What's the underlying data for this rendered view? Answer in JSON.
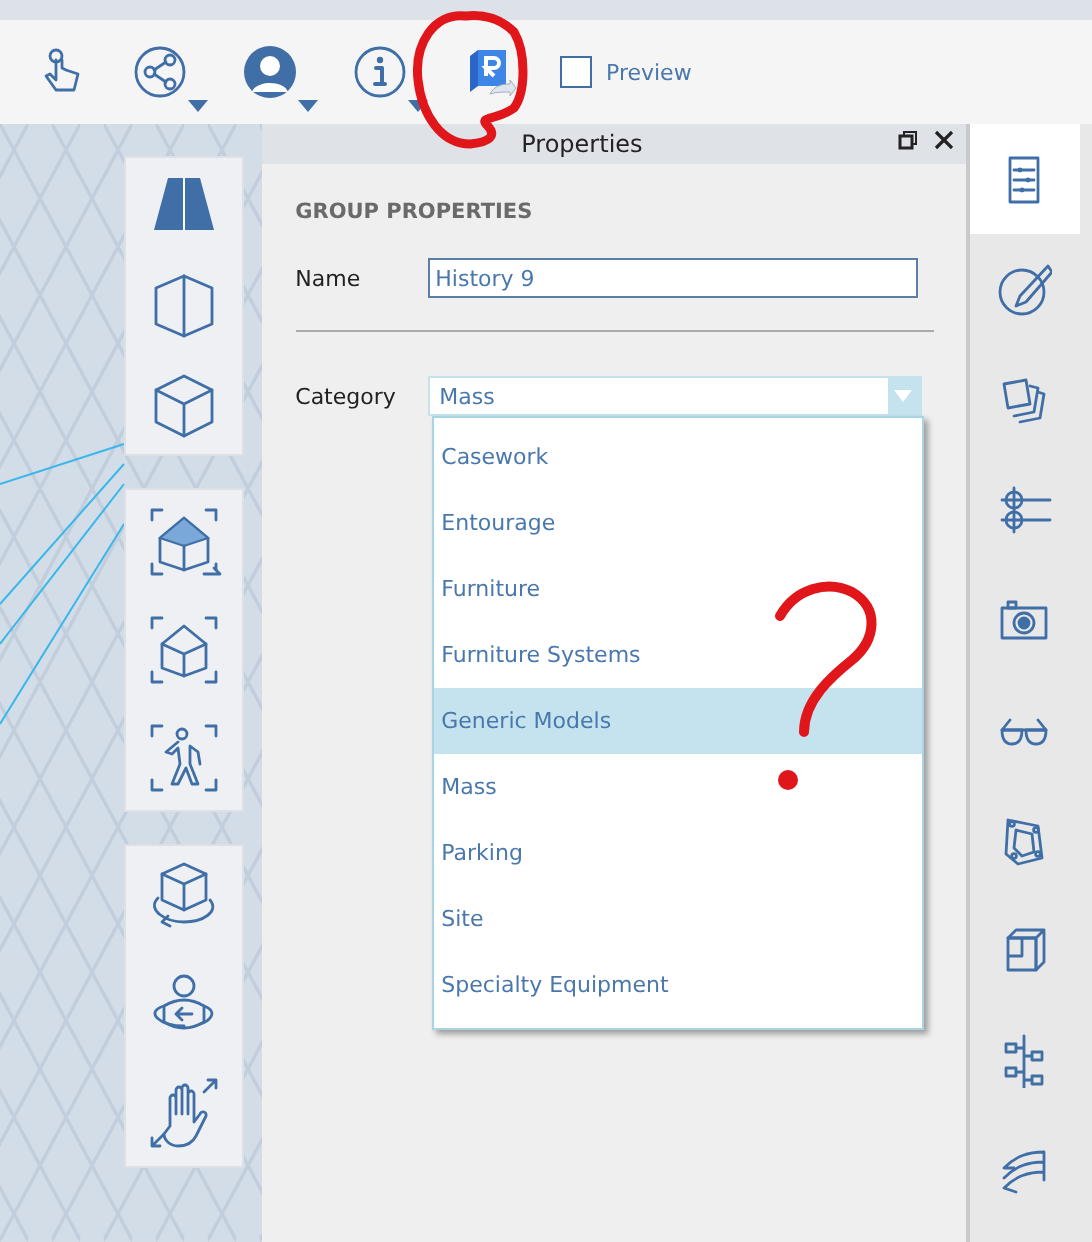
{
  "toolbar": {
    "preview": {
      "label": "Preview",
      "checked": false
    }
  },
  "properties_panel": {
    "title": "Properties",
    "section_heading": "GROUP PROPERTIES",
    "name_field": {
      "label": "Name",
      "value": "History 9"
    },
    "category_field": {
      "label": "Category",
      "value": "Mass",
      "expanded": true,
      "options": [
        {
          "label": "Casework",
          "highlighted": false
        },
        {
          "label": "Entourage",
          "highlighted": false
        },
        {
          "label": "Furniture",
          "highlighted": false
        },
        {
          "label": "Furniture Systems",
          "highlighted": false
        },
        {
          "label": "Generic Models",
          "highlighted": true
        },
        {
          "label": "Mass",
          "highlighted": false
        },
        {
          "label": "Parking",
          "highlighted": false
        },
        {
          "label": "Site",
          "highlighted": false
        },
        {
          "label": "Specialty Equipment",
          "highlighted": false
        }
      ]
    }
  },
  "sidebar_tabs": [
    {
      "selected": true
    },
    {
      "selected": false
    },
    {
      "selected": false
    },
    {
      "selected": false
    },
    {
      "selected": false
    },
    {
      "selected": false
    },
    {
      "selected": false
    },
    {
      "selected": false
    },
    {
      "selected": false
    },
    {
      "selected": false
    }
  ],
  "annotations": {
    "circle_around_export": true,
    "question_mark": true
  }
}
